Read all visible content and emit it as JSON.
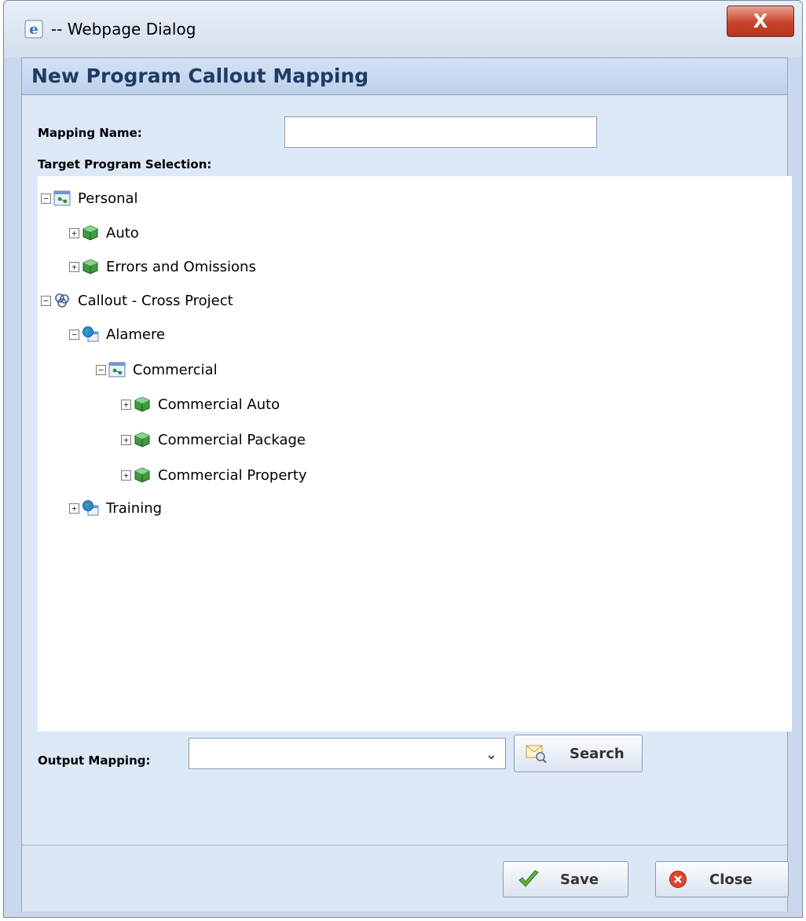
{
  "window": {
    "title": "-- Webpage Dialog",
    "close_glyph": "X"
  },
  "dialog": {
    "header": "New Program Callout Mapping",
    "mapping_name_label": "Mapping Name:",
    "mapping_name_value": "",
    "target_label": "Target Program Selection:",
    "tree": [
      {
        "label": "Personal",
        "toggle": "−",
        "icon": "program-group-icon"
      },
      {
        "label": "Auto",
        "toggle": "+",
        "icon": "green-cube-icon"
      },
      {
        "label": "Errors and Omissions",
        "toggle": "+",
        "icon": "green-cube-icon"
      },
      {
        "label": "Callout - Cross Project",
        "toggle": "−",
        "icon": "callout-icon"
      },
      {
        "label": "Alamere",
        "toggle": "−",
        "icon": "project-globe-icon"
      },
      {
        "label": "Commercial",
        "toggle": "−",
        "icon": "program-group-icon"
      },
      {
        "label": "Commercial Auto",
        "toggle": "+",
        "icon": "green-cube-icon"
      },
      {
        "label": "Commercial Package",
        "toggle": "+",
        "icon": "green-cube-icon"
      },
      {
        "label": "Commercial Property",
        "toggle": "+",
        "icon": "green-cube-icon"
      },
      {
        "label": "Training",
        "toggle": "+",
        "icon": "project-globe-icon"
      }
    ],
    "output_label": "Output Mapping:",
    "output_value": "",
    "search_label": "Search",
    "save_label": "Save",
    "close_label": "Close"
  }
}
